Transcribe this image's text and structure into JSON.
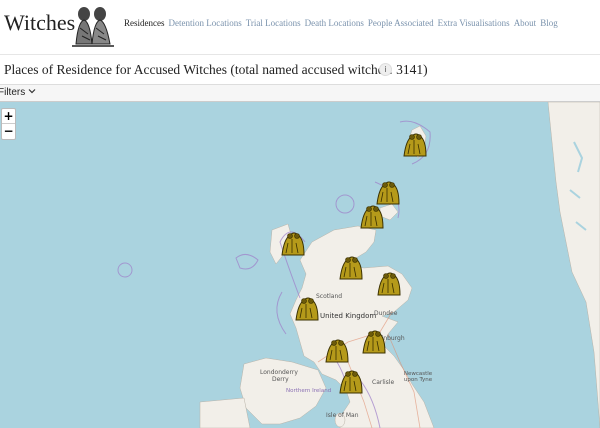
{
  "header": {
    "brand": "Witches",
    "nav": [
      {
        "label": "Residences",
        "active": true
      },
      {
        "label": "Detention Locations",
        "active": false
      },
      {
        "label": "Trial Locations",
        "active": false
      },
      {
        "label": "Death Locations",
        "active": false
      },
      {
        "label": "People Associated",
        "active": false
      },
      {
        "label": "Extra Visualisations",
        "active": false
      },
      {
        "label": "About",
        "active": false
      },
      {
        "label": "Blog",
        "active": false
      }
    ]
  },
  "page": {
    "title": "Places of Residence for Accused Witches (total named accused witches: 3141)",
    "info_icon": "i"
  },
  "filters": {
    "label": "Filters"
  },
  "map": {
    "zoom_in": "+",
    "zoom_out": "−",
    "labels": {
      "scotland": "Scotland",
      "united_kingdom": "United Kingdom",
      "dundee": "Dundee",
      "edinburgh": "Edinburgh",
      "londonderry": "Londonderry",
      "derry": "Derry",
      "northern_ireland": "Northern Ireland",
      "carlisle": "Carlisle",
      "newcastle": "Newcastle upon Tyne",
      "isle_of_man": "Isle of Man"
    },
    "colors": {
      "sea": "#aad3df",
      "land": "#f2efe9",
      "marker": "#b59a1a",
      "boundary": "#9e7ec9"
    }
  }
}
